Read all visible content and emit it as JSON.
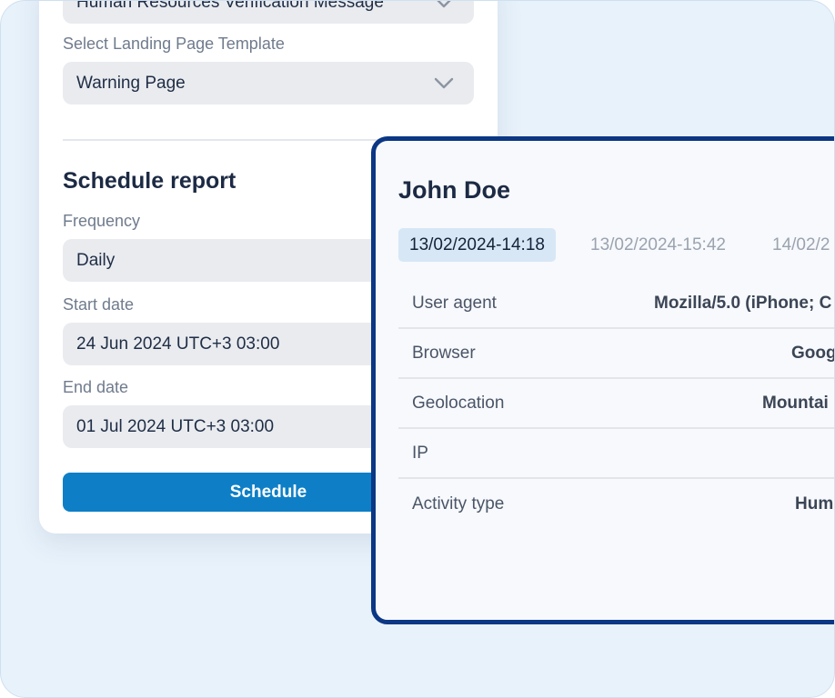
{
  "form": {
    "email_template_value": "Human Resources Verification Message",
    "landing_label": "Select Landing Page Template",
    "landing_value": "Warning Page",
    "schedule_title": "Schedule report",
    "frequency_label": "Frequency",
    "frequency_value": "Daily",
    "start_label": "Start date",
    "start_value": "24 Jun 2024 UTC+3 03:00",
    "end_label": "End date",
    "end_value": "01 Jul 2024 UTC+3 03:00",
    "schedule_button": "Schedule"
  },
  "detail": {
    "name": "John Doe",
    "tabs": [
      "13/02/2024-14:18",
      "13/02/2024-15:42",
      "14/02/2"
    ],
    "rows": [
      {
        "key": "User agent",
        "value": "Mozilla/5.0 (iPhone; C"
      },
      {
        "key": "Browser",
        "value": "Goog"
      },
      {
        "key": "Geolocation",
        "value": "Mountai"
      },
      {
        "key": "IP",
        "value": ""
      },
      {
        "key": "Activity type",
        "value": "Hum"
      }
    ]
  },
  "colors": {
    "background": "#e8f2fb",
    "primary_button": "#0e7fc6",
    "panel_border": "#0b3784",
    "active_tab": "#d7e7f6"
  },
  "icons": {
    "dropdown": "chevron-down-icon"
  }
}
